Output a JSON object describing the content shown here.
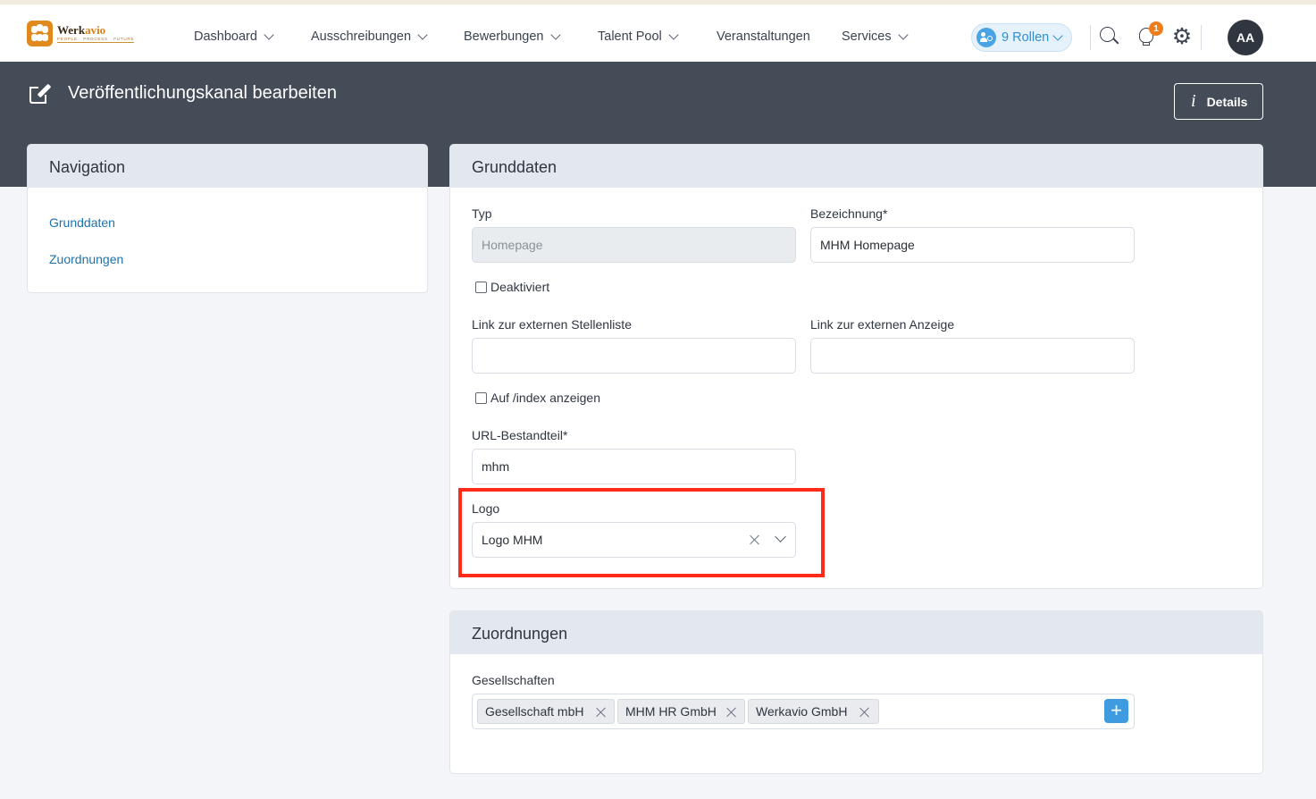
{
  "app": {
    "logo_name_a": "Werk",
    "logo_name_b": "avio",
    "logo_tagline": "PEOPLE · PROCESS · FUTURE"
  },
  "topnav": {
    "menu": [
      {
        "label": "Dashboard"
      },
      {
        "label": "Ausschreibungen"
      },
      {
        "label": "Bewerbungen"
      },
      {
        "label": "Talent Pool"
      },
      {
        "label": "Veranstaltungen"
      },
      {
        "label": "Services"
      }
    ],
    "roles_label": "9 Rollen",
    "notification_count": "1",
    "avatar_initials": "AA"
  },
  "header": {
    "title": "Veröffentlichungskanal bearbeiten",
    "details_label": "Details"
  },
  "navigation": {
    "title": "Navigation",
    "links": [
      {
        "label": "Grunddaten"
      },
      {
        "label": "Zuordnungen"
      }
    ]
  },
  "grunddaten": {
    "title": "Grunddaten",
    "typ_label": "Typ",
    "typ_value": "Homepage",
    "bezeichnung_label": "Bezeichnung*",
    "bezeichnung_value": "MHM Homepage",
    "deaktiviert_label": "Deaktiviert",
    "stellenliste_label": "Link zur externen Stellenliste",
    "stellenliste_value": "",
    "anzeige_label": "Link zur externen Anzeige",
    "anzeige_value": "",
    "index_label": "Auf /index anzeigen",
    "url_label": "URL-Bestandteil*",
    "url_value": "mhm",
    "logo_label": "Logo",
    "logo_value": "Logo MHM"
  },
  "zuordnungen": {
    "title": "Zuordnungen",
    "gesellschaften_label": "Gesellschaften",
    "tags": [
      {
        "label": "Gesellschaft mbH"
      },
      {
        "label": "MHM HR GmbH"
      },
      {
        "label": "Werkavio GmbH"
      }
    ],
    "add_label": "+"
  },
  "colors": {
    "header_band": "#444c57",
    "link": "#1d72ad",
    "accent_blue": "#3f9be0",
    "highlight": "#ff2a1a",
    "badge": "#f07d1c"
  }
}
